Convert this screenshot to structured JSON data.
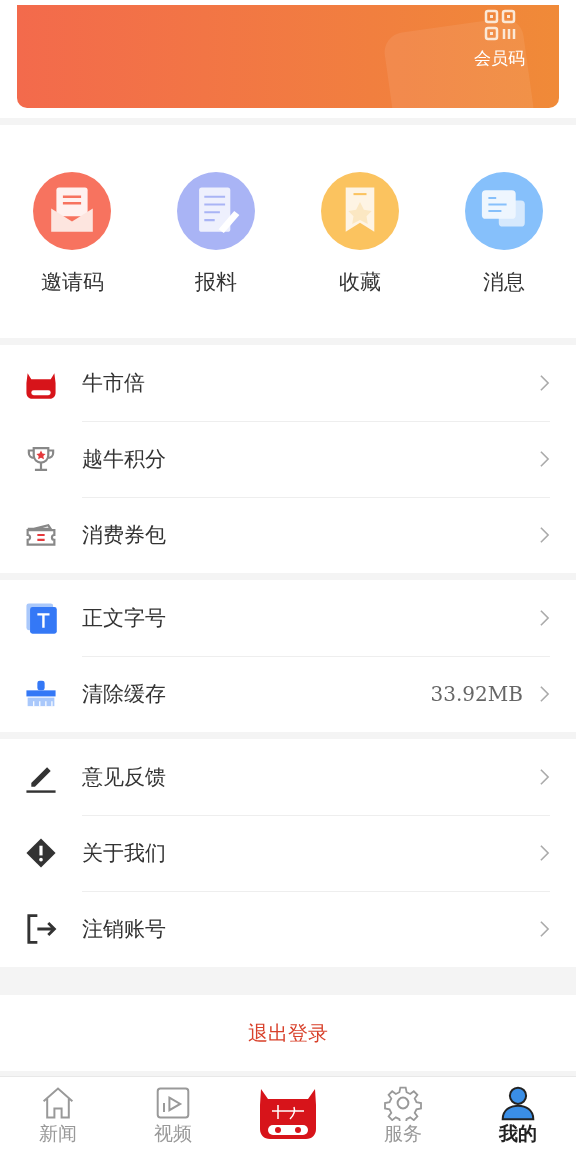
{
  "banner": {
    "member_code_label": "会员码"
  },
  "shortcuts": [
    {
      "label": "邀请码",
      "color": "#f7735f"
    },
    {
      "label": "报料",
      "color": "#a9b4f5"
    },
    {
      "label": "收藏",
      "color": "#fbc35f"
    },
    {
      "label": "消息",
      "color": "#86c0fb"
    }
  ],
  "menu_groups": [
    [
      {
        "label": "牛市倍"
      },
      {
        "label": "越牛积分"
      },
      {
        "label": "消费券包"
      }
    ],
    [
      {
        "label": "正文字号"
      },
      {
        "label": "清除缓存",
        "value": "33.92MB"
      }
    ],
    [
      {
        "label": "意见反馈"
      },
      {
        "label": "关于我们"
      },
      {
        "label": "注销账号"
      }
    ]
  ],
  "logout_label": "退出登录",
  "tab_bar": [
    {
      "kind": "tab",
      "label": "新闻",
      "selected": false
    },
    {
      "kind": "tab",
      "label": "视频",
      "selected": false
    },
    {
      "kind": "logo"
    },
    {
      "kind": "tab",
      "label": "服务",
      "selected": false
    },
    {
      "kind": "tab",
      "label": "我的",
      "selected": true
    }
  ]
}
